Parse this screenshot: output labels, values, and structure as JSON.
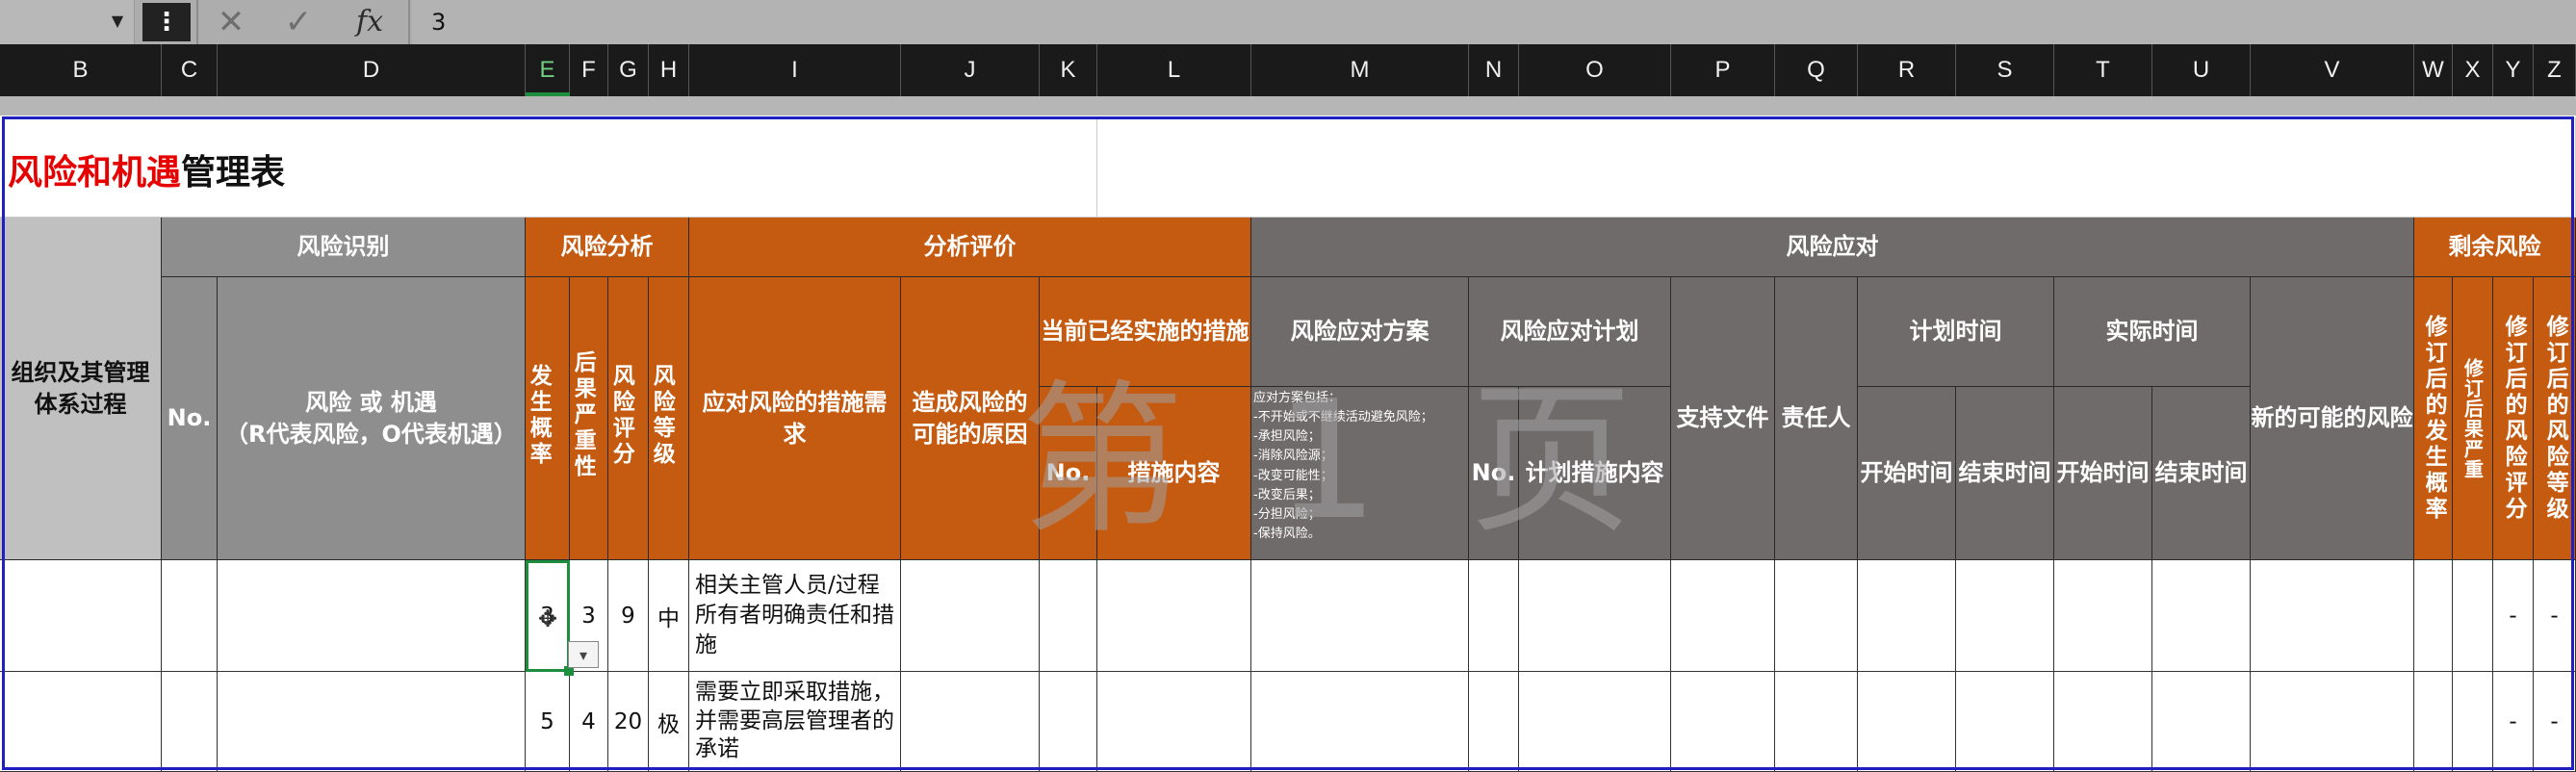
{
  "formula_bar": {
    "cancel_icon": "x-icon",
    "enter_icon": "check-icon",
    "fx_label": "fx",
    "value": "3"
  },
  "columns": [
    "B",
    "C",
    "D",
    "E",
    "F",
    "G",
    "H",
    "I",
    "J",
    "K",
    "L",
    "M",
    "N",
    "O",
    "P",
    "Q",
    "R",
    "S",
    "T",
    "U",
    "V",
    "W",
    "X",
    "Y",
    "Z"
  ],
  "title": {
    "red_part": "风险和机遇",
    "black_part": "管理表"
  },
  "groups": {
    "org_process": "组织及其管理体系过程",
    "risk_id": "风险识别",
    "risk_analysis": "风险分析",
    "eval": "分析评价",
    "response": "风险应对",
    "residual": "剩余风险"
  },
  "headers": {
    "no": "No.",
    "risk_or_opp": "风险 或 机遇",
    "risk_or_opp_note": "（R代表风险，O代表机遇）",
    "probability": "发生概率",
    "severity": "后果严重性",
    "score": "风险评分",
    "level": "风险等级",
    "measures_needed": "应对风险的措施需求",
    "causes": "造成风险的可能的原因",
    "current_measures": "当前已经实施的措施",
    "cm_no": "No.",
    "cm_content": "措施内容",
    "plan_scheme": "风险应对方案",
    "plan": "风险应对计划",
    "plan_no": "No.",
    "plan_content": "计划措施内容",
    "support_docs": "支持文件",
    "owner": "责任人",
    "plan_time": "计划时间",
    "actual_time": "实际时间",
    "start_time": "开始时间",
    "end_time": "结束时间",
    "new_risk": "新的可能的风险",
    "rev_probability": "修订后的发生概率",
    "rev_severity": "修订后的后果严重性",
    "rev_severity_short": "修订后果严重",
    "rev_score": "修订后的风险评分",
    "rev_level": "修订后的风险等级"
  },
  "response_options": [
    "应对方案包括：",
    "-不开始或不继续活动避免风险；",
    "-承担风险；",
    "-消除风险源；",
    "-改变可能性；",
    "-改变后果；",
    "-分担风险；",
    "-保持风险。"
  ],
  "watermark": "第 1 页",
  "rows": [
    {
      "probability": "3",
      "severity": "3",
      "score": "9",
      "level": "中",
      "measures": "相关主管人员/过程所有者明确责任和措施",
      "rev_score": "-",
      "rev_level": "-"
    },
    {
      "probability": "5",
      "severity": "4",
      "score": "20",
      "level": "极",
      "measures": "需要立即采取措施，并需要高层管理者的承诺",
      "rev_score": "-",
      "rev_level": "-"
    }
  ],
  "colors": {
    "orange": "#c55a11",
    "dark_gray": "#6f6b6b",
    "mid_gray": "#8e8e8e",
    "light_gray": "#c0c0c0",
    "title_red": "#e60000",
    "selection_green": "#1e8e3e"
  }
}
